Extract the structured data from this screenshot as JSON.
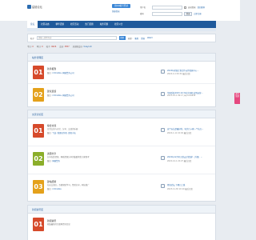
{
  "header": {
    "logo_text": "星链论坛",
    "qq_login_label": "用QQ帐号登录",
    "fast_login_label": "快捷登录",
    "username_label": "用户名",
    "password_label": "密码",
    "remember_label": "自动登录",
    "find_password_link": "找回密码",
    "register_link": "立即注册",
    "login_button": "登录"
  },
  "nav": {
    "items": [
      {
        "label": "论坛",
        "active": true
      },
      {
        "label": "社区动态",
        "active": false
      },
      {
        "label": "精华话题",
        "active": false
      },
      {
        "label": "社区活动",
        "active": false
      },
      {
        "label": "热门话题",
        "active": false
      },
      {
        "label": "站务问题",
        "active": false
      },
      {
        "label": "社区公告",
        "active": false
      }
    ]
  },
  "search": {
    "scope_label": "帖子",
    "placeholder": "请输入搜索内容",
    "button_label": "搜索",
    "hot_label": "热搜:",
    "hot_tags": [
      "教程",
      "资源",
      "Web3"
    ]
  },
  "stats": {
    "today_label": "今日:",
    "today_value": "0",
    "yesterday_label": "昨日:",
    "yesterday_value": "0",
    "posts_label": "帖子:",
    "posts_value": "9626",
    "members_label": "会员:",
    "members_value": "3857",
    "newest_label": "欢迎新会员:",
    "newest_value": "Yuleyindi"
  },
  "sections": [
    {
      "title": "站务管理区",
      "forums": [
        {
          "num": "01",
          "color": "#d64a2b",
          "name": "新手报到",
          "moderators_label": "版主:",
          "moderators": "mrtrubba, 网络警务公司",
          "last_title": "2024年星链计划合作伙伴招募中心...",
          "last_time": "2024-4-1 09:32 最后回复"
        },
        {
          "num": "02",
          "color": "#e4a11b",
          "name": "建议反馈",
          "moderators_label": "版主:",
          "moderators": "mrtrubba, 网络警务公司",
          "last_title": "苹果系统2023.10.31在中国区达到运营...",
          "last_time": "2023-10-1 09:17 jaycloha639"
        }
      ]
    },
    {
      "title": "交流讨论区",
      "forums": [
        {
          "num": "01",
          "color": "#d64a2b",
          "name": "综合交流",
          "desc": "日常交流与讨论、分享、交流的乐园",
          "moderators_label": "版主:",
          "moderators": "飞龙, 管理员作者, 游戏小站",
          "last_title": "这个玩法是最好的，每次几十家一个站点...",
          "last_time": "2024-1-11 10:02 最后回复"
        },
        {
          "num": "02",
          "color": "#8bae2a",
          "name": "资源分享",
          "desc": "分享各类资源、网络资源分享的集散地供大家参考",
          "moderators_label": "版主:",
          "moderators": "网络警务",
          "last_title": "2022年12月2日论坛正常维护（升级）...",
          "last_time": "2022-12-1 22:27 最后回复"
        },
        {
          "num": "03",
          "color": "#e4a11b",
          "name": "建站经验",
          "desc": "站长交流区，互相帮助学习，经验分享，网站推广",
          "moderators_label": "版主:",
          "moderators": "mrtrubba",
          "last_title": "星链论坛 下期已上线",
          "last_time": "2023-11-30 10:10 最后回复"
        }
      ]
    },
    {
      "title": "新闻资讯区",
      "forums": [
        {
          "num": "01",
          "color": "#d64a2b",
          "name": "新闻资讯",
          "desc": "收集最新的互联网资讯信息",
          "moderators_label": "",
          "moderators": "",
          "last_title": "",
          "last_time": ""
        }
      ]
    }
  ],
  "right_tab": "返回顶部"
}
